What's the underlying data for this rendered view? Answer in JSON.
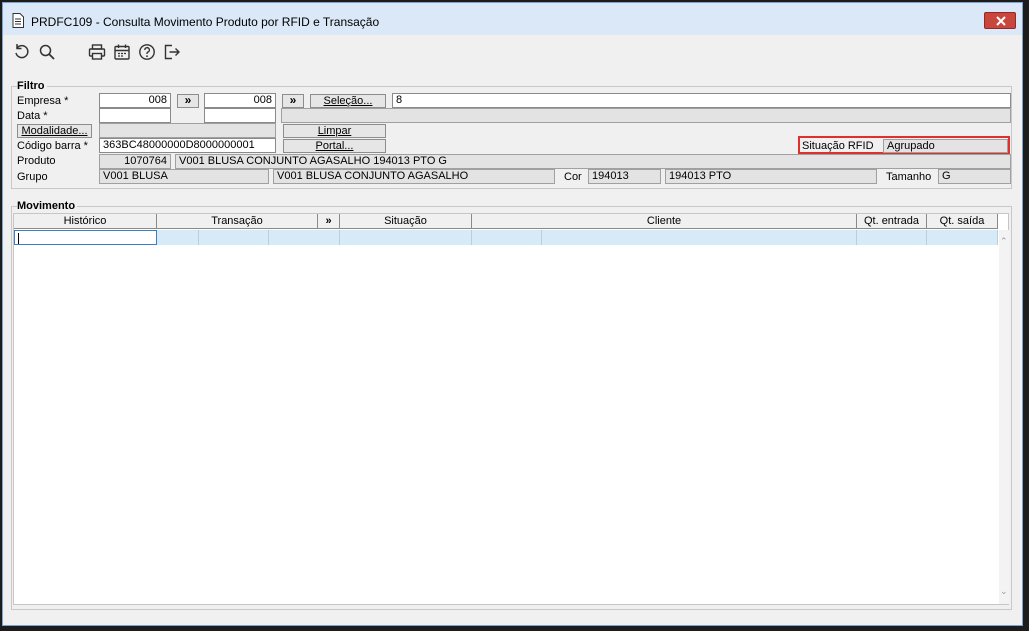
{
  "window": {
    "title": "PRDFC109 - Consulta Movimento Produto por RFID e Transação"
  },
  "toolbar": {
    "icons": [
      "refresh-icon",
      "search-icon",
      "print-icon",
      "calendar-icon",
      "help-icon",
      "exit-icon"
    ]
  },
  "filtro": {
    "legend": "Filtro",
    "empresa_label": "Empresa *",
    "empresa_from": "008",
    "empresa_to": "008",
    "arrow": "»",
    "selecao_button": "Seleção...",
    "selecao_value": "8",
    "data_label": "Data *",
    "data_from": "",
    "data_to": "",
    "modalidade_button": "Modalidade...",
    "limpar_button": "Limpar",
    "codigo_barra_label": "Código barra *",
    "codigo_barra_value": "363BC48000000D8000000001",
    "portal_button": "Portal...",
    "situacao_rfid_label": "Situação RFID",
    "situacao_rfid_value": "Agrupado",
    "produto_label": "Produto",
    "produto_code": "1070764",
    "produto_desc": "V001 BLUSA CONJUNTO AGASALHO 194013 PTO G",
    "grupo_label": "Grupo",
    "grupo_code": "V001 BLUSA",
    "grupo_desc": "V001 BLUSA CONJUNTO AGASALHO",
    "cor_label": "Cor",
    "cor_code": "194013",
    "cor_desc": "194013 PTO",
    "tamanho_label": "Tamanho",
    "tamanho_value": "G"
  },
  "movimento": {
    "legend": "Movimento",
    "columns": [
      "Histórico",
      "Transação",
      "»",
      "Situação",
      "Cliente",
      "Qt. entrada",
      "Qt. saída"
    ]
  }
}
